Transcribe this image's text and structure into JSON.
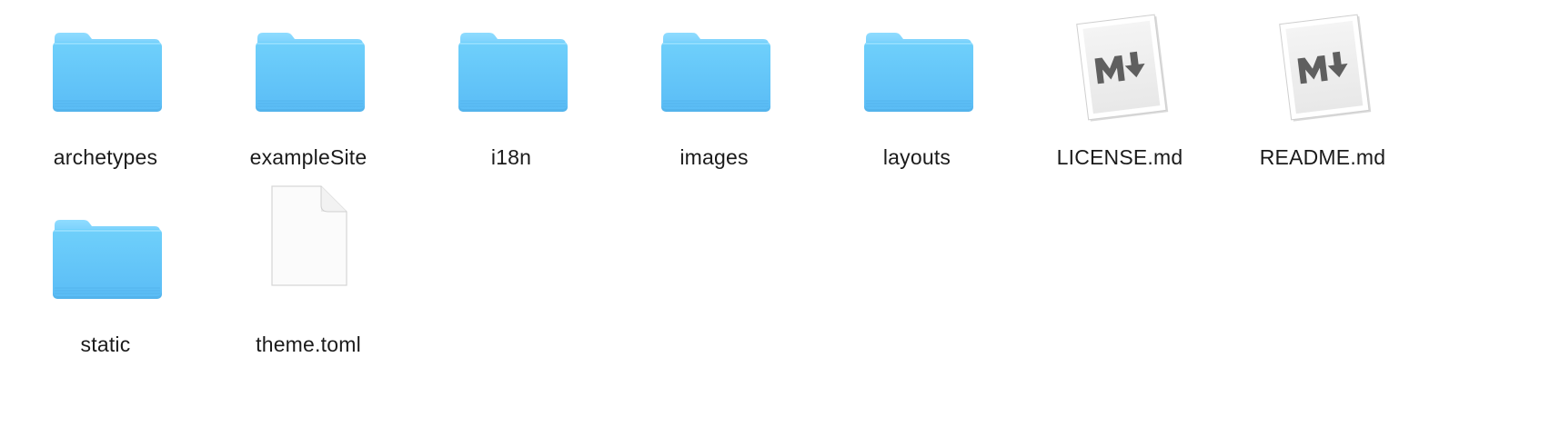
{
  "window": {
    "view": "icon-view"
  },
  "colors": {
    "folder_front": "#63c5f8",
    "folder_back": "#4fb4f0",
    "label_text": "#1b1b1b"
  },
  "items": [
    {
      "label": "archetypes",
      "kind": "folder",
      "icon": "folder-icon"
    },
    {
      "label": "exampleSite",
      "kind": "folder",
      "icon": "folder-icon"
    },
    {
      "label": "i18n",
      "kind": "folder",
      "icon": "folder-icon"
    },
    {
      "label": "images",
      "kind": "folder",
      "icon": "folder-icon"
    },
    {
      "label": "layouts",
      "kind": "folder",
      "icon": "folder-icon"
    },
    {
      "label": "LICENSE.md",
      "kind": "markdown",
      "icon": "markdown-file-icon"
    },
    {
      "label": "README.md",
      "kind": "markdown",
      "icon": "markdown-file-icon"
    },
    {
      "label": "static",
      "kind": "folder",
      "icon": "folder-icon"
    },
    {
      "label": "theme.toml",
      "kind": "file",
      "icon": "document-icon"
    }
  ]
}
